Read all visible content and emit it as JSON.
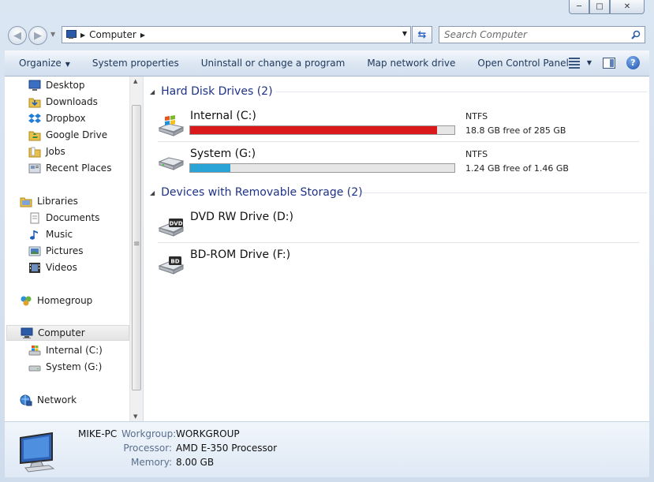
{
  "window": {
    "minimize_glyph": "─",
    "maximize_glyph": "□",
    "close_glyph": "✕"
  },
  "address": {
    "crumb": "Computer",
    "search_placeholder": "Search Computer"
  },
  "toolbar": {
    "organize": "Organize",
    "system_properties": "System properties",
    "uninstall": "Uninstall or change a program",
    "map_drive": "Map network drive",
    "control_panel": "Open Control Panel",
    "help": "?"
  },
  "nav": {
    "favorites": [
      {
        "label": "Desktop",
        "icon": "desktop-icon"
      },
      {
        "label": "Downloads",
        "icon": "downloads-icon"
      },
      {
        "label": "Dropbox",
        "icon": "dropbox-icon"
      },
      {
        "label": "Google Drive",
        "icon": "google-drive-icon"
      },
      {
        "label": "Jobs",
        "icon": "folder-icon"
      },
      {
        "label": "Recent Places",
        "icon": "recent-places-icon"
      }
    ],
    "libraries": "Libraries",
    "library_items": [
      {
        "label": "Documents",
        "icon": "documents-icon"
      },
      {
        "label": "Music",
        "icon": "music-icon"
      },
      {
        "label": "Pictures",
        "icon": "pictures-icon"
      },
      {
        "label": "Videos",
        "icon": "videos-icon"
      }
    ],
    "homegroup": "Homegroup",
    "computer": "Computer",
    "computer_items": [
      {
        "label": "Internal (C:)",
        "icon": "windows-drive-icon"
      },
      {
        "label": "System (G:)",
        "icon": "hard-drive-icon"
      }
    ],
    "network": "Network"
  },
  "groups": {
    "hdd": "Hard Disk Drives (2)",
    "removable": "Devices with Removable Storage (2)"
  },
  "drives": [
    {
      "name": "Internal (C:)",
      "fs": "NTFS",
      "free": "18.8 GB free of 285 GB",
      "used_fraction": 0.934,
      "bar_color": "#da1a1a"
    },
    {
      "name": "System (G:)",
      "fs": "NTFS",
      "free": "1.24 GB free of 1.46 GB",
      "used_fraction": 0.151,
      "bar_color": "#2aa3d6"
    }
  ],
  "removable": [
    {
      "name": "DVD RW Drive (D:)",
      "badge": "DVD"
    },
    {
      "name": "BD-ROM Drive (F:)",
      "badge": "BD"
    }
  ],
  "details": {
    "pc_name": "MIKE-PC",
    "workgroup_label": "Workgroup:",
    "workgroup": "WORKGROUP",
    "processor_label": "Processor:",
    "processor": "AMD E-350 Processor",
    "memory_label": "Memory:",
    "memory": "8.00 GB"
  }
}
